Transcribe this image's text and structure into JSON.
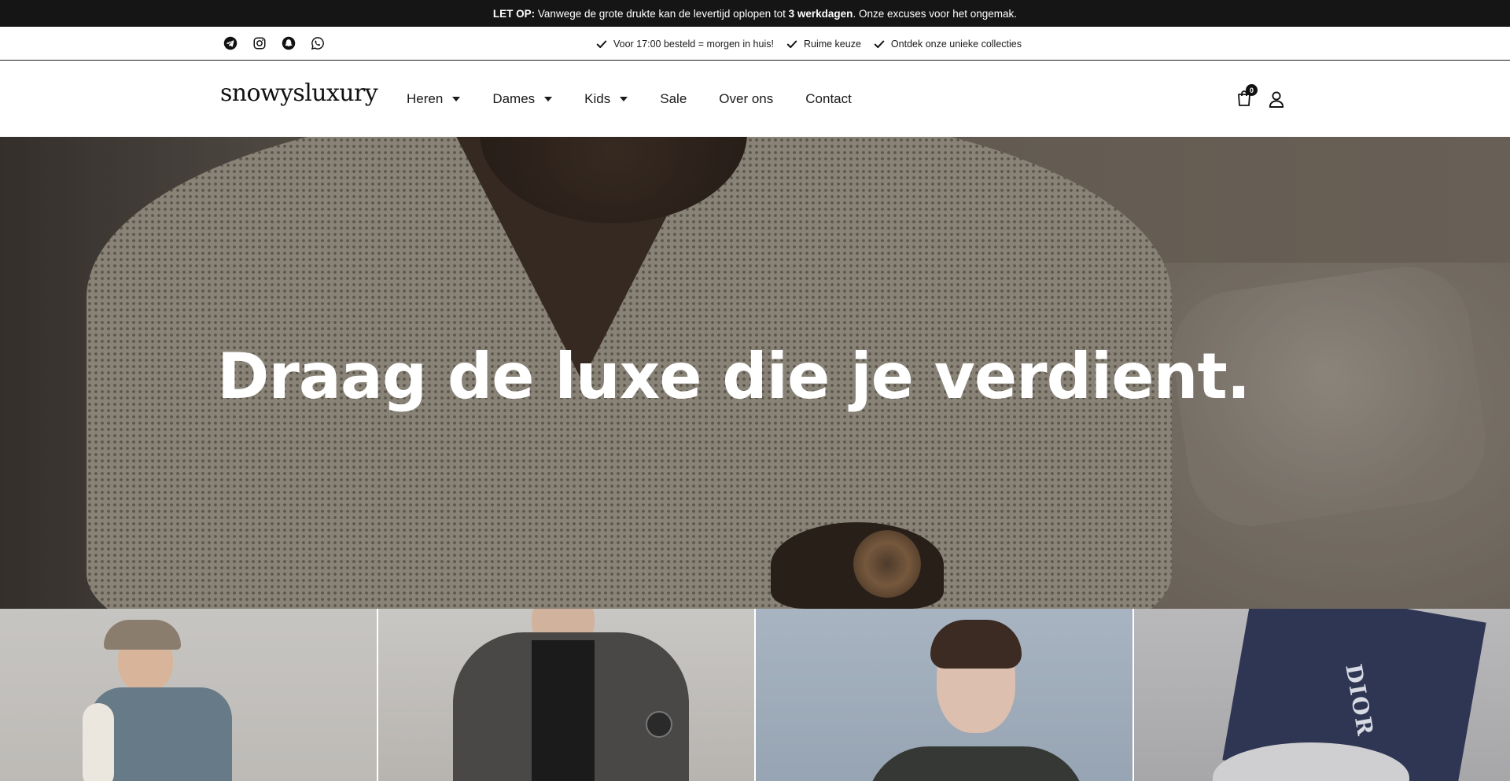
{
  "announcement": {
    "prefix": "LET OP:",
    "text_before": " Vanwege de grote drukte kan de levertijd oplopen tot ",
    "highlight": "3 werkdagen",
    "text_after": ". Onze excuses voor het ongemak."
  },
  "socials": [
    {
      "icon": "telegram-icon"
    },
    {
      "icon": "instagram-icon"
    },
    {
      "icon": "snapchat-icon"
    },
    {
      "icon": "whatsapp-icon"
    }
  ],
  "usps": [
    {
      "label": "Voor 17:00 besteld = morgen in huis!"
    },
    {
      "label": "Ruime keuze"
    },
    {
      "label": "Ontdek onze unieke collecties"
    }
  ],
  "header": {
    "logo": "snowysluxury",
    "nav": [
      {
        "label": "Heren",
        "dropdown": true
      },
      {
        "label": "Dames",
        "dropdown": true
      },
      {
        "label": "Kids",
        "dropdown": true
      },
      {
        "label": "Sale",
        "dropdown": false
      },
      {
        "label": "Over ons",
        "dropdown": false
      },
      {
        "label": "Contact",
        "dropdown": false
      }
    ],
    "cart_count": "0"
  },
  "hero": {
    "title": "Draag de luxe die je verdient."
  },
  "tiles": [
    {
      "name": "tile-puffer-vest"
    },
    {
      "name": "tile-down-jacket"
    },
    {
      "name": "tile-knit-sweater"
    },
    {
      "name": "tile-dior-sneaker",
      "brand_mark": "DIOR"
    }
  ],
  "colors": {
    "announcement_bg": "#151515",
    "text": "#111111",
    "white": "#ffffff"
  }
}
